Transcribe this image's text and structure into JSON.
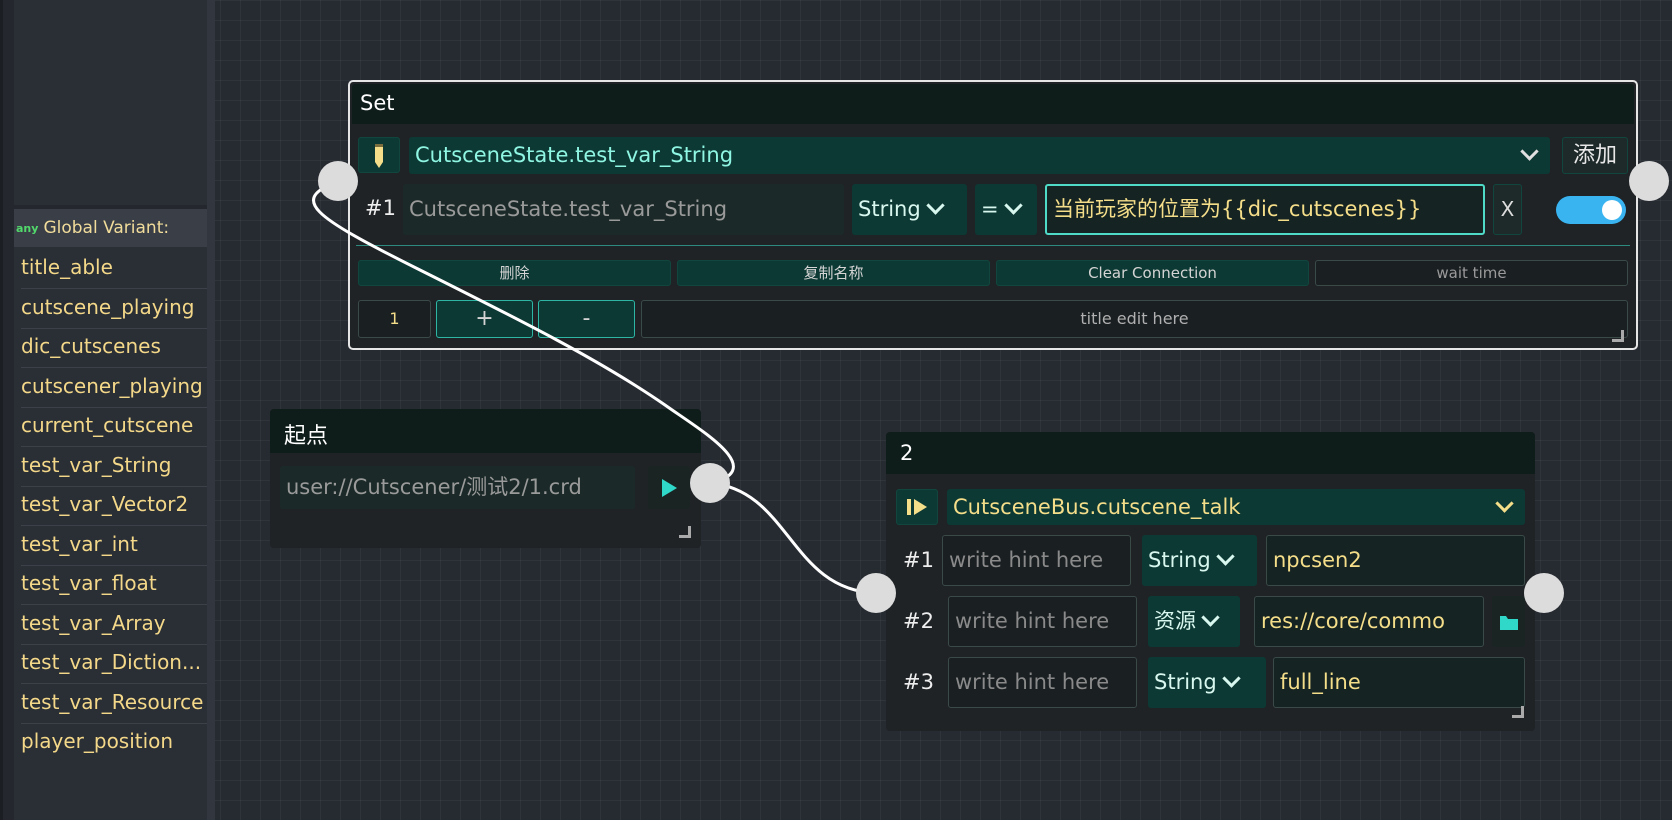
{
  "global_variants": {
    "any_badge": "any",
    "title": "Global Variant:",
    "items": [
      "title_able",
      "cutscene_playing",
      "dic_cutscenes",
      "cutscener_playing",
      "current_cutscene",
      "test_var_String",
      "test_var_Vector2",
      "test_var_int",
      "test_var_float",
      "test_var_Array",
      "test_var_Diction...",
      "test_var_Resource",
      "player_position"
    ]
  },
  "set_node": {
    "title": "Set",
    "variable_select": "CutsceneState.test_var_String",
    "add_button": "添加",
    "row": {
      "index": "#1",
      "name_value": "CutsceneState.test_var_String",
      "type_select": "String",
      "op_select": "=",
      "value": "当前玩家的位置为{{dic_cutscenes}}",
      "remove": "X",
      "enabled": true
    },
    "actions": [
      "删除",
      "复制名称",
      "Clear Connection",
      "wait time"
    ],
    "counter": "1",
    "plus": "+",
    "minus": "-",
    "title_placeholder": "title edit here"
  },
  "start_node": {
    "title": "起点",
    "path": "user://Cutscener/测试2/1.crd"
  },
  "talk_node": {
    "title": "2",
    "signal_select": "CutsceneBus.cutscene_talk",
    "hint_placeholder": "write hint here",
    "rows": [
      {
        "index": "#1",
        "type": "String",
        "value": "npcsen2"
      },
      {
        "index": "#2",
        "type": "资源",
        "value": "res://core/commo"
      },
      {
        "index": "#3",
        "type": "String",
        "value": "full_line"
      }
    ]
  },
  "colors": {
    "accent_text": "#f5de8a",
    "cyan_text": "#7ff5e0",
    "toggle": "#3ab4f0",
    "title_bar": "#0e1c1a"
  }
}
